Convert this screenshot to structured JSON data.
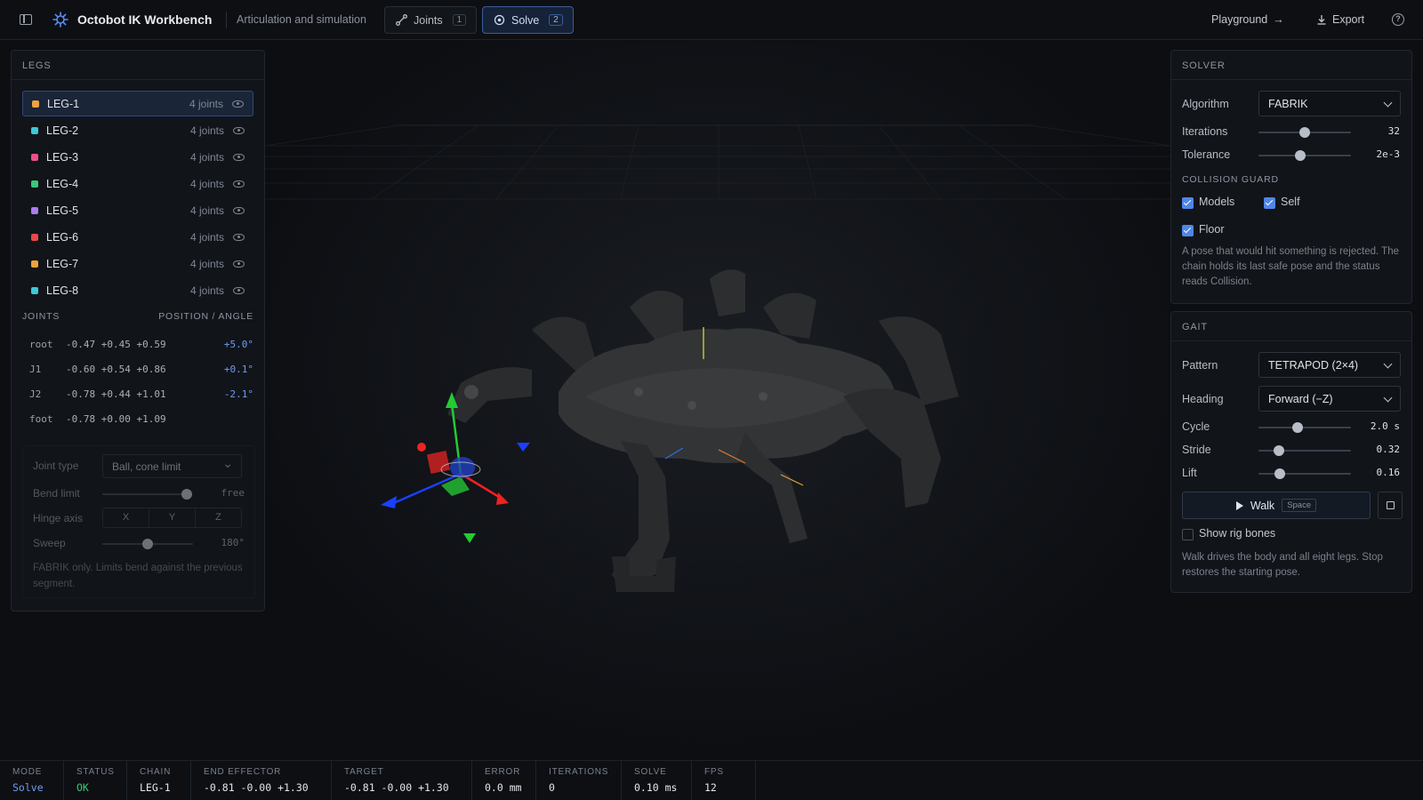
{
  "header": {
    "app_title": "Octobot IK Workbench",
    "app_subtitle": "Articulation and simulation",
    "tabs": [
      {
        "label": "Joints",
        "badge": "1"
      },
      {
        "label": "Solve",
        "badge": "2"
      }
    ],
    "playground_label": "Playground",
    "export_label": "Export",
    "help_glyph": "?"
  },
  "legs_panel": {
    "title": "LEGS",
    "legs": [
      {
        "name": "LEG-1",
        "count": "4 joints",
        "color": "#f0a03c",
        "selected": true
      },
      {
        "name": "LEG-2",
        "count": "4 joints",
        "color": "#3cc8d8"
      },
      {
        "name": "LEG-3",
        "count": "4 joints",
        "color": "#e84f8c"
      },
      {
        "name": "LEG-4",
        "count": "4 joints",
        "color": "#3cc878"
      },
      {
        "name": "LEG-5",
        "count": "4 joints",
        "color": "#a87cf0"
      },
      {
        "name": "LEG-6",
        "count": "4 joints",
        "color": "#e84848"
      },
      {
        "name": "LEG-7",
        "count": "4 joints",
        "color": "#f0a03c"
      },
      {
        "name": "LEG-8",
        "count": "4 joints",
        "color": "#3cc8d8"
      }
    ],
    "joints_label": "JOINTS",
    "position_label": "POSITION / ANGLE",
    "joints": [
      {
        "name": "root",
        "pos": "-0.47 +0.45 +0.59",
        "angle": "+5.0°"
      },
      {
        "name": "J1",
        "pos": "-0.60 +0.54 +0.86",
        "angle": "+0.1°"
      },
      {
        "name": "J2",
        "pos": "-0.78 +0.44 +1.01",
        "angle": "-2.1°"
      },
      {
        "name": "foot",
        "pos": "-0.78 +0.00 +1.09",
        "angle": ""
      }
    ],
    "joint_type_label": "Joint type",
    "joint_type_value": "Ball, cone limit",
    "bend_limit_label": "Bend limit",
    "bend_limit_value": "free",
    "bend_limit_fraction": 0.95,
    "hinge_axis_label": "Hinge axis",
    "hinge_axes": [
      "X",
      "Y",
      "Z"
    ],
    "sweep_label": "Sweep",
    "sweep_value": "180°",
    "sweep_fraction": 0.5,
    "joint_note": "FABRIK only. Limits bend against the previous segment."
  },
  "solver_panel": {
    "title": "SOLVER",
    "algorithm_label": "Algorithm",
    "algorithm_value": "FABRIK",
    "iterations_label": "Iterations",
    "iterations_value": "32",
    "iterations_fraction": 0.5,
    "tolerance_label": "Tolerance",
    "tolerance_value": "2e-3",
    "tolerance_fraction": 0.45,
    "collision_label": "COLLISION GUARD",
    "models_label": "Models",
    "self_label": "Self",
    "floor_label": "Floor",
    "collision_note": "A pose that would hit something is rejected. The chain holds its last safe pose and the status reads Collision."
  },
  "gait_panel": {
    "title": "GAIT",
    "pattern_label": "Pattern",
    "pattern_value": "TETRAPOD (2×4)",
    "heading_label": "Heading",
    "heading_value": "Forward (−Z)",
    "cycle_label": "Cycle",
    "cycle_value": "2.0 s",
    "cycle_fraction": 0.42,
    "stride_label": "Stride",
    "stride_value": "0.32",
    "stride_fraction": 0.22,
    "lift_label": "Lift",
    "lift_value": "0.16",
    "lift_fraction": 0.23,
    "walk_label": "Walk",
    "walk_key": "Space",
    "rig_bones_label": "Show rig bones",
    "gait_note": "Walk drives the body and all eight legs. Stop restores the starting pose."
  },
  "statusbar": [
    {
      "key": "MODE",
      "value": "Solve",
      "color": "#6f9cf0"
    },
    {
      "key": "STATUS",
      "value": "OK",
      "color": "#3cc878"
    },
    {
      "key": "CHAIN",
      "value": "LEG-1",
      "color": "#e2e6ec"
    },
    {
      "key": "END EFFECTOR",
      "value": "-0.81 -0.00 +1.30",
      "color": "#e2e6ec"
    },
    {
      "key": "TARGET",
      "value": "-0.81 -0.00 +1.30",
      "color": "#e2e6ec"
    },
    {
      "key": "ERROR",
      "value": "0.0 mm",
      "color": "#e2e6ec"
    },
    {
      "key": "ITERATIONS",
      "value": "0",
      "color": "#e2e6ec"
    },
    {
      "key": "SOLVE",
      "value": "0.10 ms",
      "color": "#e2e6ec"
    },
    {
      "key": "FPS",
      "value": "12",
      "color": "#e2e6ec"
    }
  ]
}
